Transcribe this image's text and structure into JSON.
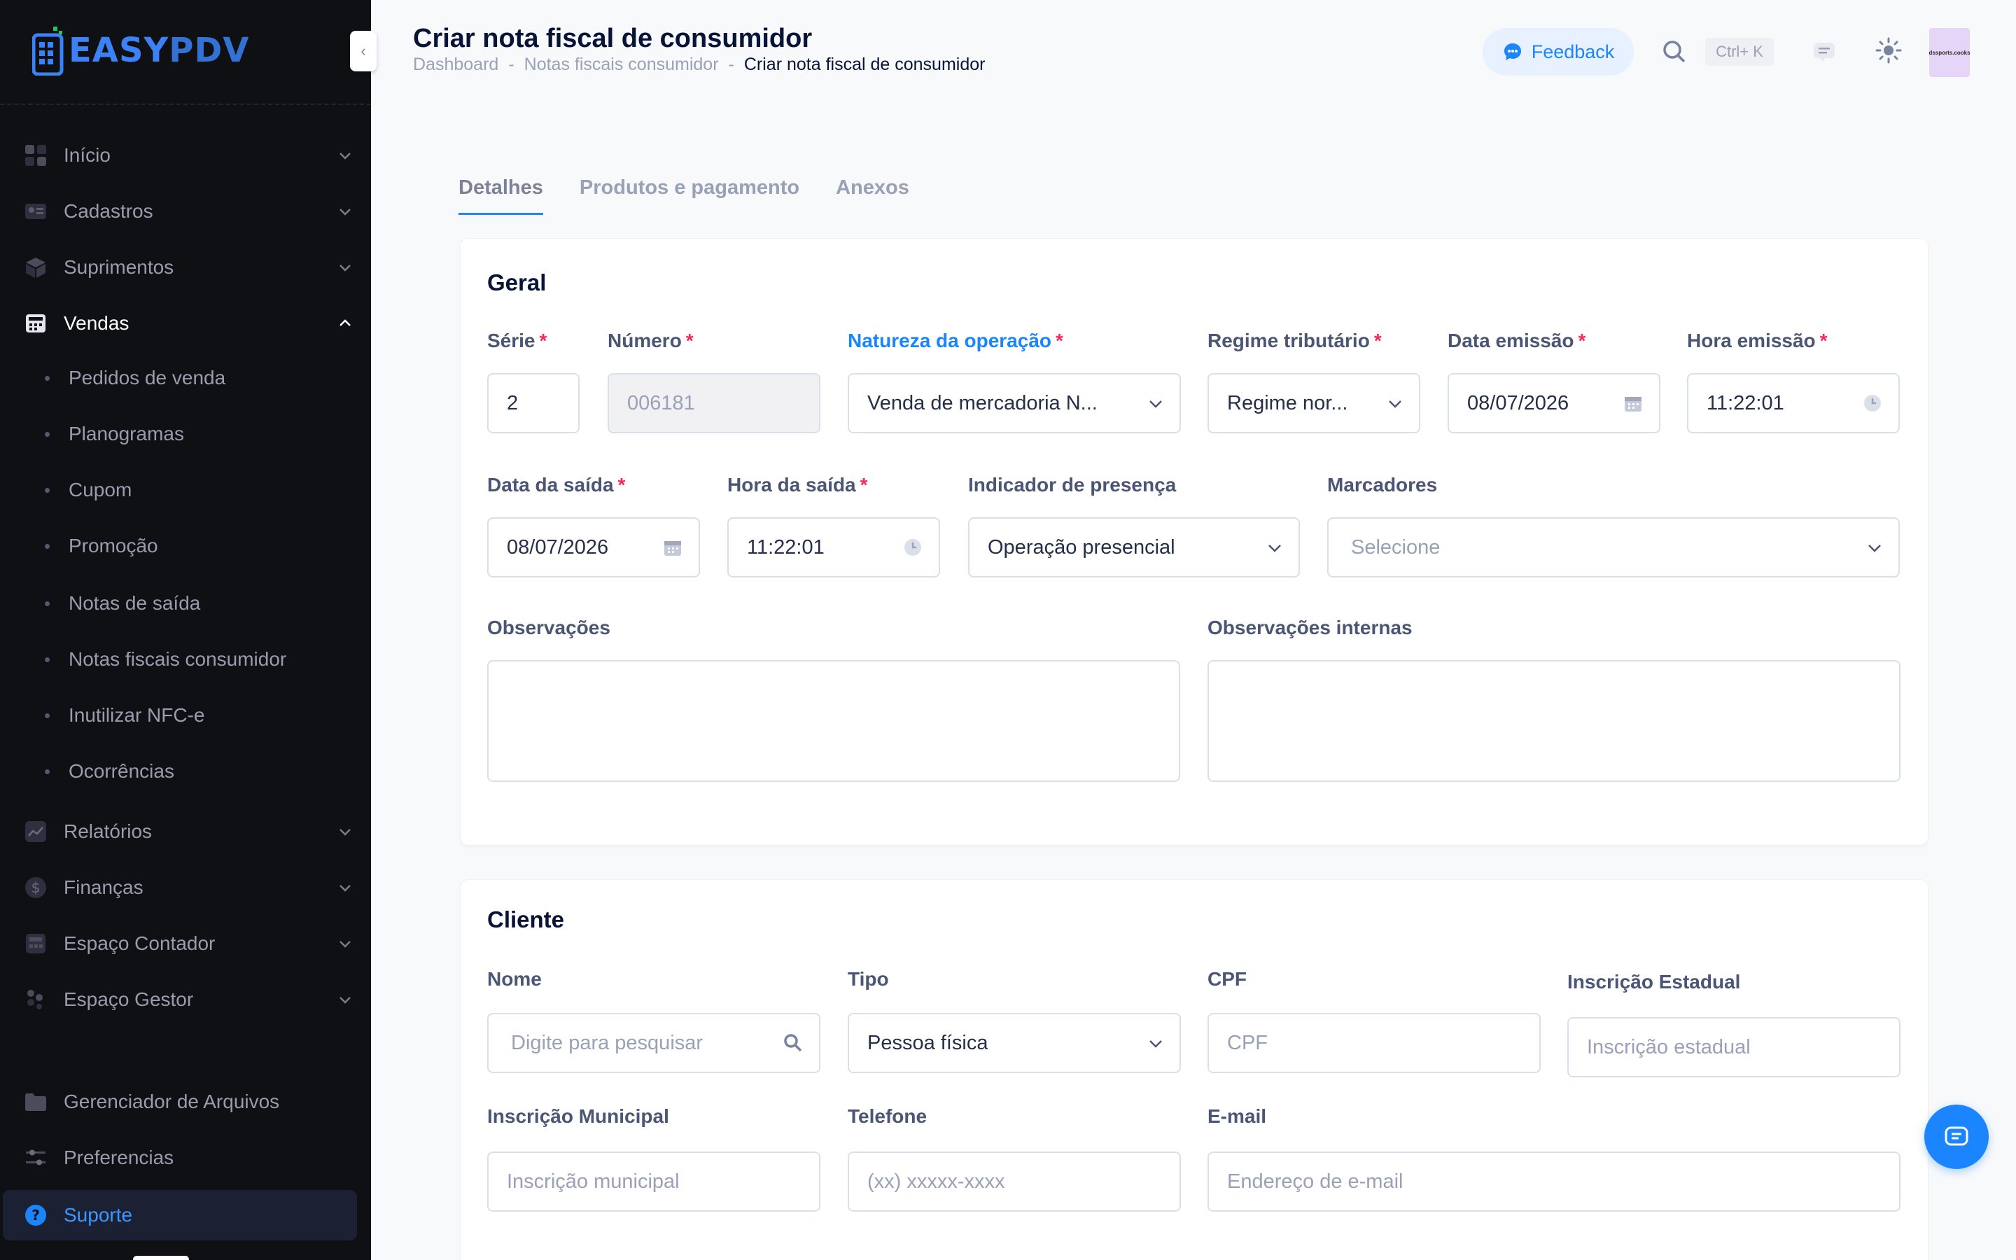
{
  "app": {
    "logo_easy": "EASY",
    "logo_pdv": "PDV"
  },
  "colors": {
    "accent": "#1b84ff",
    "sidebar_bg": "#0f1014",
    "required": "#f8285a"
  },
  "sidebar": {
    "items": [
      {
        "label": "Início",
        "icon": "grid-icon"
      },
      {
        "label": "Cadastros",
        "icon": "id-card-icon"
      },
      {
        "label": "Suprimentos",
        "icon": "box-icon"
      },
      {
        "label": "Vendas",
        "icon": "register-icon"
      },
      {
        "label": "Relatórios",
        "icon": "chart-icon"
      },
      {
        "label": "Finanças",
        "icon": "dollar-icon"
      },
      {
        "label": "Espaço Contador",
        "icon": "calculator-icon"
      },
      {
        "label": "Espaço Gestor",
        "icon": "people-icon"
      },
      {
        "label": "Gerenciador de Arquivos",
        "icon": "folder-icon"
      },
      {
        "label": "Preferencias",
        "icon": "sliders-icon"
      }
    ],
    "vendas_sub": [
      "Pedidos de venda",
      "Planogramas",
      "Cupom",
      "Promoção",
      "Notas de saída",
      "Notas fiscais consumidor",
      "Inutilizar NFC-e",
      "Ocorrências"
    ],
    "support_label": "Suporte"
  },
  "header": {
    "title": "Criar nota fiscal de consumidor",
    "breadcrumb": [
      "Dashboard",
      "Notas fiscais consumidor",
      "Criar nota fiscal de consumidor"
    ],
    "feedback_label": "Feedback",
    "shortcut": "Ctrl+ K",
    "avatar_text": "dssports.cooks"
  },
  "tabs": [
    "Detalhes",
    "Produtos e pagamento",
    "Anexos"
  ],
  "geral": {
    "title": "Geral",
    "serie": {
      "label": "Série",
      "value": "2"
    },
    "numero": {
      "label": "Número",
      "value": "006181"
    },
    "natureza": {
      "label": "Natureza da operação",
      "value": "Venda de mercadoria N..."
    },
    "regime": {
      "label": "Regime tributário",
      "value": "Regime nor..."
    },
    "data_emissao": {
      "label": "Data emissão",
      "value": "08/07/2026"
    },
    "hora_emissao": {
      "label": "Hora emissão",
      "value": "11:22:01"
    },
    "data_saida": {
      "label": "Data da saída",
      "value": "08/07/2026"
    },
    "hora_saida": {
      "label": "Hora da saída",
      "value": "11:22:01"
    },
    "presenca": {
      "label": "Indicador de presença",
      "value": "Operação presencial"
    },
    "marcadores": {
      "label": "Marcadores",
      "placeholder": "Selecione"
    },
    "observacoes": {
      "label": "Observações"
    },
    "observacoes_internas": {
      "label": "Observações internas"
    }
  },
  "cliente": {
    "title": "Cliente",
    "nome": {
      "label": "Nome",
      "placeholder": "Digite para pesquisar"
    },
    "tipo": {
      "label": "Tipo",
      "value": "Pessoa física"
    },
    "cpf": {
      "label": "CPF",
      "placeholder": "CPF"
    },
    "ie": {
      "label": "Inscrição Estadual",
      "placeholder": "Inscrição estadual"
    },
    "im": {
      "label": "Inscrição Municipal",
      "placeholder": "Inscrição municipal"
    },
    "telefone": {
      "label": "Telefone",
      "placeholder": "(xx) xxxxx-xxxx"
    },
    "email": {
      "label": "E-mail",
      "placeholder": "Endereço de e-mail"
    }
  }
}
